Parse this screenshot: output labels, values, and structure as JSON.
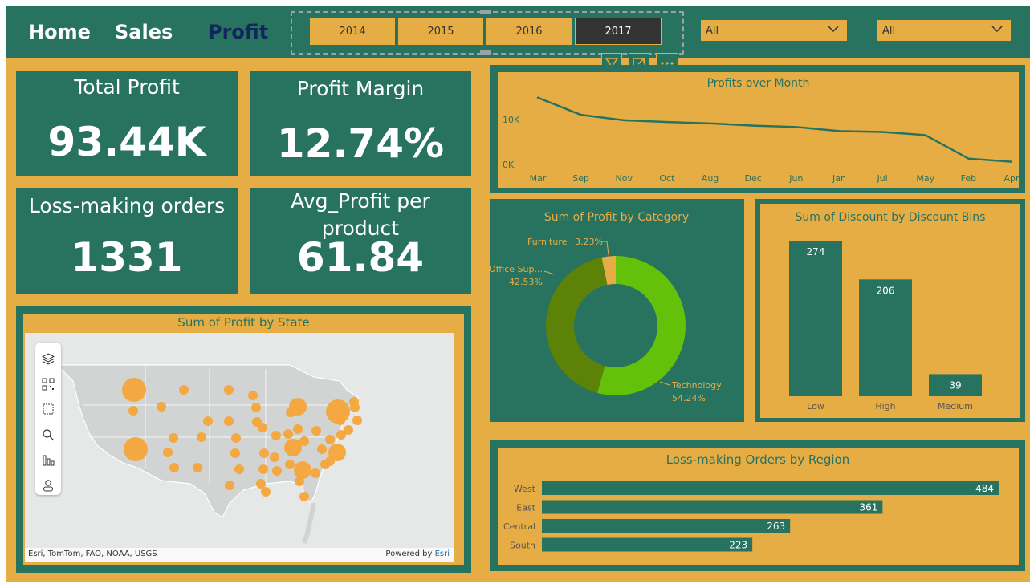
{
  "nav": {
    "home": "Home",
    "sales": "Sales",
    "profit": "Profit"
  },
  "year_slicer": {
    "years": [
      "2014",
      "2015",
      "2016",
      "2017"
    ],
    "selected": "2017"
  },
  "dropdowns": [
    {
      "value": "All"
    },
    {
      "value": "All"
    }
  ],
  "kpis": {
    "total_profit": {
      "label": "Total Profit",
      "value": "93.44K"
    },
    "profit_margin": {
      "label": "Profit Margin",
      "value": "12.74%"
    },
    "loss_orders": {
      "label": "Loss-making orders",
      "value": "1331"
    },
    "avg_profit": {
      "label_line1": "Avg_Profit per",
      "label_line2": "product",
      "value": "61.84"
    }
  },
  "visual_header": {
    "icons": [
      "filter-icon",
      "focus-mode-icon",
      "more-options-icon"
    ]
  },
  "map": {
    "title": "Sum of Profit by State",
    "attribution": "Esri, TomTom, FAO, NOAA, USGS",
    "powered_by": "Powered by",
    "powered_by_link": "Esri",
    "tools": [
      "layers-icon",
      "qr-code-icon",
      "select-rectangle-icon",
      "search-icon",
      "bar-chart-icon",
      "person-icon"
    ]
  },
  "colors": {
    "teal": "#287260",
    "gold": "#e6ad45",
    "navy": "#14245c",
    "bubble": "#f5a53a",
    "tech": "#64c10a",
    "office": "#5c8207",
    "furniture": "#e6ad45"
  },
  "chart_data": [
    {
      "type": "line",
      "title": "Profits over Month",
      "categories": [
        "Mar",
        "Sep",
        "Nov",
        "Oct",
        "Aug",
        "Dec",
        "Jun",
        "Jan",
        "Jul",
        "May",
        "Feb",
        "Apr"
      ],
      "values": [
        14800,
        11000,
        9800,
        9400,
        9100,
        8600,
        8300,
        7400,
        7200,
        6500,
        1300,
        600
      ],
      "ytick_labels": [
        "10K",
        "0K"
      ],
      "yticks": [
        10000,
        0
      ],
      "ylim": [
        0,
        16000
      ]
    },
    {
      "type": "pie",
      "title": "Sum of Profit by Category",
      "labels": [
        "Technology",
        "Office Sup...",
        "Furniture"
      ],
      "percent_labels": [
        "54.24%",
        "42.53%",
        "3.23%"
      ],
      "values": [
        54.24,
        42.53,
        3.23
      ]
    },
    {
      "type": "bar",
      "title": "Sum of Discount by Discount Bins",
      "categories": [
        "Low",
        "High",
        "Medium"
      ],
      "values": [
        274,
        206,
        39
      ],
      "ylim": [
        0,
        280
      ]
    },
    {
      "type": "bar",
      "orientation": "horizontal",
      "title": "Loss-making Orders by Region",
      "categories": [
        "West",
        "East",
        "Central",
        "South"
      ],
      "values": [
        484,
        361,
        263,
        223
      ],
      "xlim": [
        0,
        484
      ]
    }
  ]
}
